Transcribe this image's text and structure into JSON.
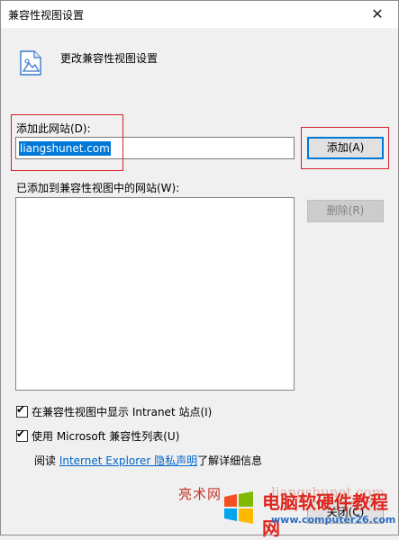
{
  "window": {
    "title": "兼容性视图设置",
    "close_glyph": "✕"
  },
  "header": {
    "icon": "compatibility-view-icon",
    "text": "更改兼容性视图设置"
  },
  "add_site": {
    "label": "添加此网站(D):",
    "value": "liangshunet.com",
    "button": "添加(A)"
  },
  "site_list": {
    "label": "已添加到兼容性视图中的网站(W):",
    "items": [],
    "remove_button": "删除(R)"
  },
  "options": {
    "intranet": {
      "label": "在兼容性视图中显示 Intranet 站点(I)",
      "checked": true
    },
    "ms_list": {
      "label": "使用 Microsoft 兼容性列表(U)",
      "checked": true
    }
  },
  "info": {
    "prefix": "阅读 ",
    "link": "Internet Explorer 隐私声明",
    "suffix": "了解详细信息"
  },
  "footer": {
    "close_button": "关闭(C)"
  },
  "watermark": {
    "left_text": "亮术网",
    "mid_text": "liangshunet.com",
    "brand": "电脑软硬件教程网",
    "url": "www.computer26.com"
  },
  "colors": {
    "selection": "#0078d7",
    "highlight_box": "#d4202a",
    "link": "#0066cc"
  }
}
